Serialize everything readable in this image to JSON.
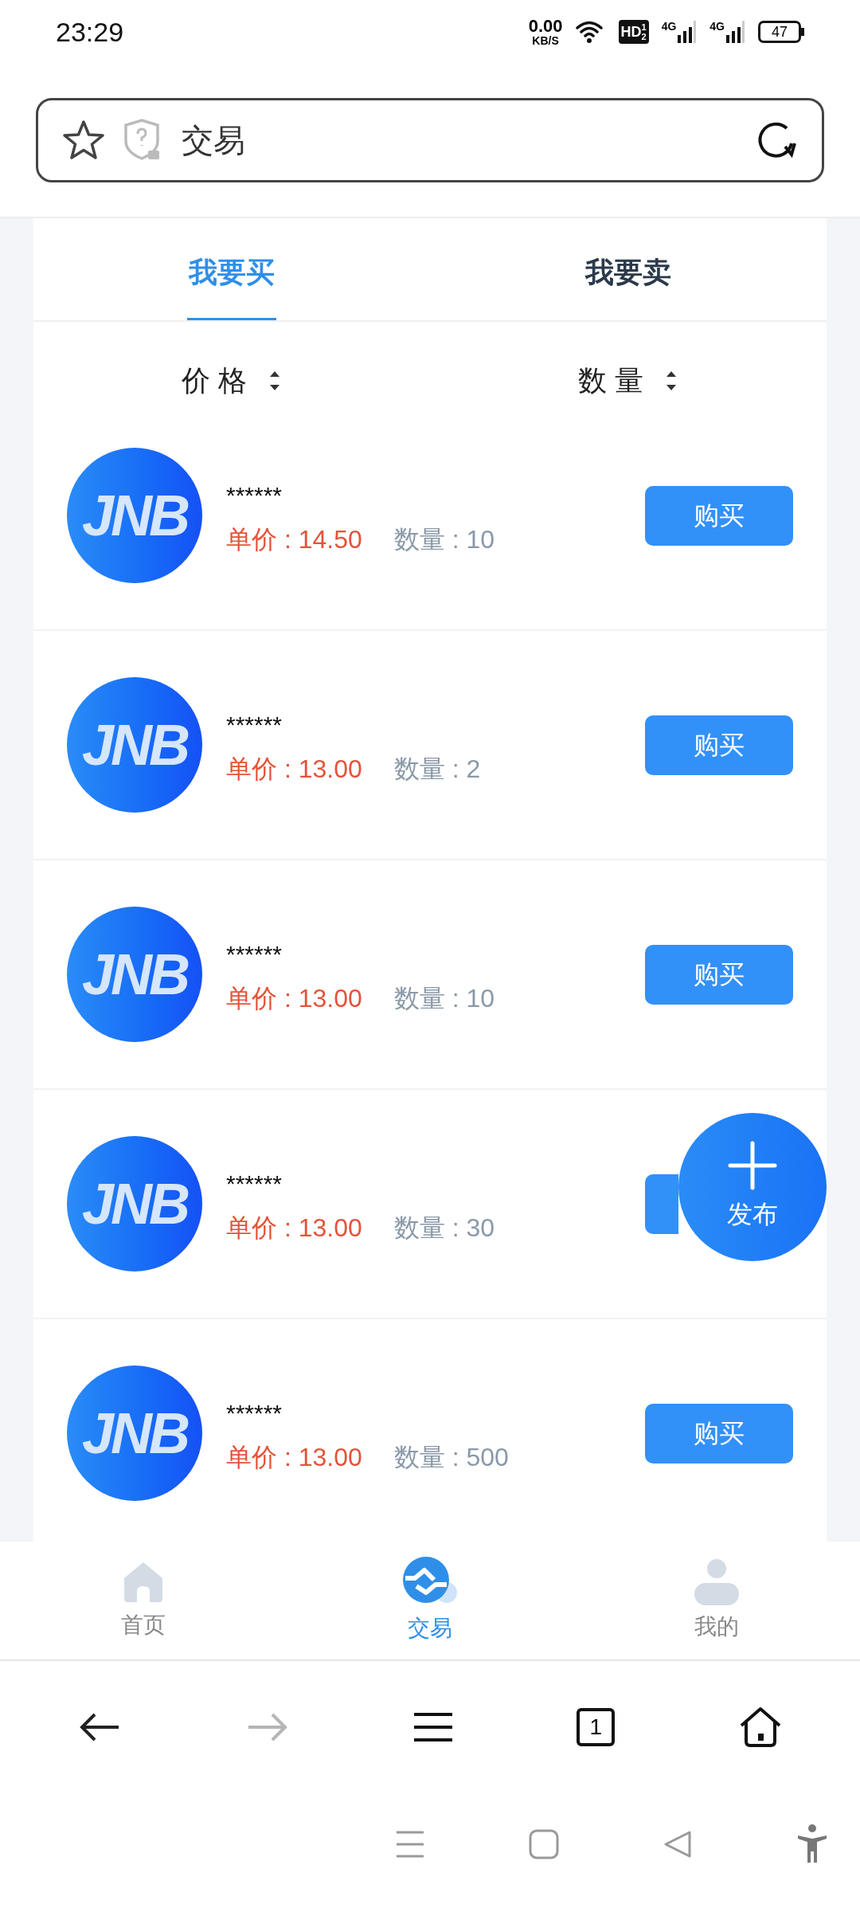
{
  "status_bar": {
    "time": "23:29",
    "net_speed": "0.00",
    "net_unit": "KB/S",
    "hd": "HD",
    "hd_sup": "1",
    "hd_sub": "2",
    "signals": [
      "4G",
      "4G"
    ],
    "battery": "47"
  },
  "address_bar": {
    "title": "交易"
  },
  "tabs": [
    {
      "label": "我要买",
      "selected": true
    },
    {
      "label": "我要卖",
      "selected": false
    }
  ],
  "sort": [
    {
      "label": "价 格"
    },
    {
      "label": "数 量"
    }
  ],
  "listings": [
    {
      "logo": "JNB",
      "name": "******",
      "price": "单价 : 14.50",
      "quantity": "数量 : 10",
      "button": "购买"
    },
    {
      "logo": "JNB",
      "name": "******",
      "price": "单价 : 13.00",
      "quantity": "数量 : 2",
      "button": "购买"
    },
    {
      "logo": "JNB",
      "name": "******",
      "price": "单价 : 13.00",
      "quantity": "数量 : 10",
      "button": "购买"
    },
    {
      "logo": "JNB",
      "name": "******",
      "price": "单价 : 13.00",
      "quantity": "数量 : 30"
    },
    {
      "logo": "JNB",
      "name": "******",
      "price": "单价 : 13.00",
      "quantity": "数量 : 500",
      "button": "购买"
    }
  ],
  "fab": {
    "label": "发布"
  },
  "bottom_nav": [
    {
      "kind": "home",
      "label": "首页",
      "selected": false
    },
    {
      "kind": "trade",
      "label": "交易",
      "selected": true
    },
    {
      "kind": "profile",
      "label": "我的",
      "selected": false
    }
  ],
  "browser_toolbar": {
    "forward_disabled": true,
    "tab_count": "1"
  }
}
